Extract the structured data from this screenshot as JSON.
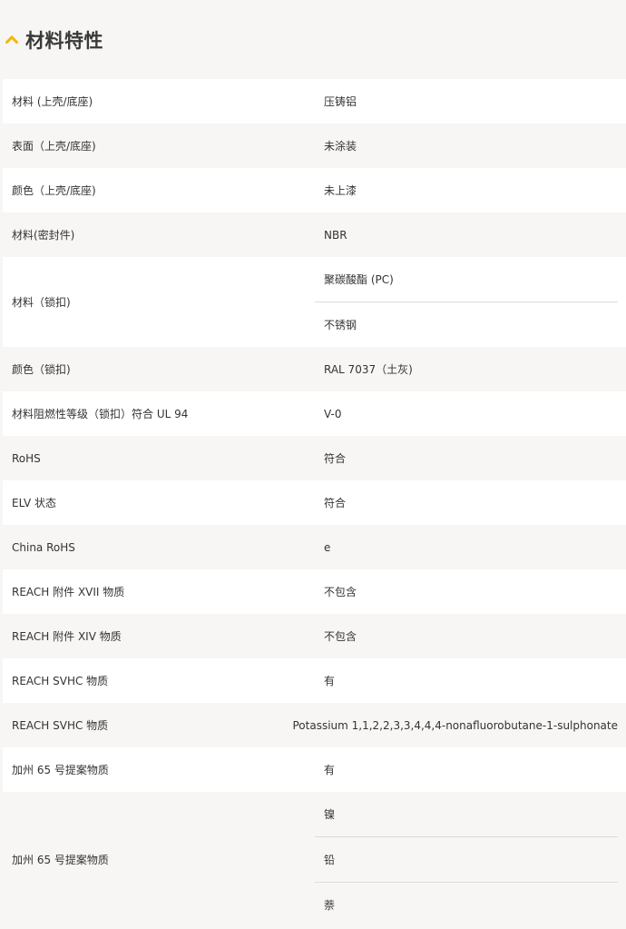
{
  "section": {
    "title": "材料特性",
    "icon": "chevron-up-icon",
    "accent_color": "#f5b700"
  },
  "rows": [
    {
      "label": "材料 (上壳/底座)",
      "values": [
        "压铸铝"
      ]
    },
    {
      "label": "表面（上壳/底座)",
      "values": [
        "未涂装"
      ]
    },
    {
      "label": "颜色（上壳/底座)",
      "values": [
        "未上漆"
      ]
    },
    {
      "label": "材料(密封件)",
      "values": [
        "NBR"
      ]
    },
    {
      "label": "材料（锁扣)",
      "values": [
        "聚碳酸酯 (PC)",
        "不锈钢"
      ]
    },
    {
      "label": "颜色（锁扣)",
      "values": [
        "RAL 7037（土灰)"
      ]
    },
    {
      "label": "材料阻燃性等级（锁扣）符合 UL 94",
      "values": [
        "V-0"
      ]
    },
    {
      "label": "RoHS",
      "values": [
        "符合"
      ]
    },
    {
      "label": "ELV 状态",
      "values": [
        "符合"
      ]
    },
    {
      "label": "China RoHS",
      "values": [
        "e"
      ]
    },
    {
      "label": "REACH 附件 XVII 物质",
      "values": [
        "不包含"
      ]
    },
    {
      "label": "REACH 附件 XIV 物质",
      "values": [
        "不包含"
      ]
    },
    {
      "label": "REACH SVHC 物质",
      "values": [
        "有"
      ]
    },
    {
      "label": "REACH SVHC 物质",
      "values": [
        "Potassium 1,1,2,2,3,3,4,4,4-nonafluorobutane-1-sulphonate"
      ]
    },
    {
      "label": "加州 65 号提案物质",
      "values": [
        "有"
      ]
    },
    {
      "label": "加州 65 号提案物质",
      "values": [
        "镍",
        "铅",
        "萘"
      ]
    }
  ]
}
